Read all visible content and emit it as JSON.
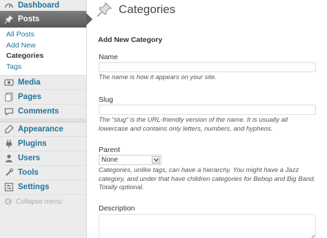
{
  "sidebar": {
    "dashboard": {
      "label": "Dashboard",
      "icon": "dashboard-icon"
    },
    "posts": {
      "label": "Posts",
      "icon": "pushpin-icon"
    },
    "posts_submenu": [
      "All Posts",
      "Add New",
      "Categories",
      "Tags"
    ],
    "items": [
      {
        "label": "Media",
        "icon": "media-icon"
      },
      {
        "label": "Pages",
        "icon": "pages-icon"
      },
      {
        "label": "Comments",
        "icon": "comments-icon"
      }
    ],
    "items2": [
      {
        "label": "Appearance",
        "icon": "appearance-icon"
      },
      {
        "label": "Plugins",
        "icon": "plugins-icon"
      },
      {
        "label": "Users",
        "icon": "users-icon"
      },
      {
        "label": "Tools",
        "icon": "tools-icon"
      },
      {
        "label": "Settings",
        "icon": "settings-icon"
      }
    ],
    "collapse_label": "Collapse menu"
  },
  "main": {
    "title": "Categories",
    "section_title": "Add New Category",
    "name": {
      "label": "Name",
      "value": "",
      "help": "The name is how it appears on your site."
    },
    "slug": {
      "label": "Slug",
      "value": "",
      "help": "The “slug” is the URL-friendly version of the name. It is usually all lowercase and contains only letters, numbers, and hyphens."
    },
    "parent": {
      "label": "Parent",
      "selected": "None",
      "help": "Categories, unlike tags, can have a hierarchy. You might have a Jazz category, and under that have children categories for Bebop and Big Band. Totally optional."
    },
    "description": {
      "label": "Description",
      "value": ""
    }
  },
  "colors": {
    "link": "#21759b",
    "current_menu_bg": "#5f5f5f",
    "sidebar_bg": "#ececec"
  }
}
